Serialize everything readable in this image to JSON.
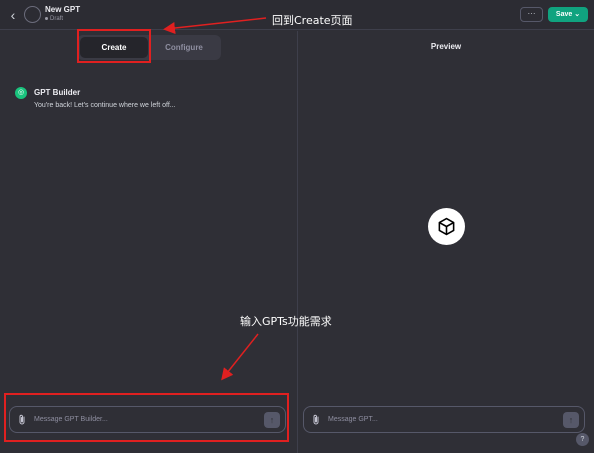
{
  "header": {
    "back_icon": "chevron-left-icon",
    "title": "New GPT",
    "status": "Draft",
    "more_label": "···",
    "save_label": "Save ⌄",
    "save_color": "#10a37f"
  },
  "tabs": [
    {
      "label": "Create",
      "active": true
    },
    {
      "label": "Configure",
      "active": false
    }
  ],
  "chat": {
    "sender": "GPT Builder",
    "message": "You're back! Let's continue where we left off...",
    "input_placeholder": "Message GPT Builder..."
  },
  "preview": {
    "title": "Preview",
    "logo_icon": "cube-icon",
    "input_placeholder": "Message GPT..."
  },
  "help_label": "?",
  "annotations": {
    "create_note": "回到Create页面",
    "input_note": "输入GPTs功能需求",
    "color": "#e02020"
  }
}
